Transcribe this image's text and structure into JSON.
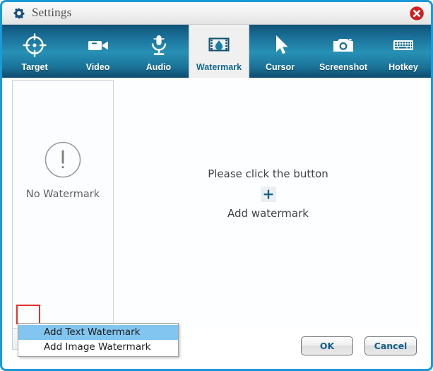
{
  "window": {
    "title": "Settings",
    "title_icon": "gear-icon",
    "close_icon": "close-icon",
    "accent_blue": "#1b9ad6",
    "close_red": "#e02020"
  },
  "tabs": [
    {
      "label": "Target",
      "icon": "target-icon",
      "active": false
    },
    {
      "label": "Video",
      "icon": "video-camera-icon",
      "active": false
    },
    {
      "label": "Audio",
      "icon": "microphone-icon",
      "active": false
    },
    {
      "label": "Watermark",
      "icon": "watermark-icon",
      "active": true
    },
    {
      "label": "Cursor",
      "icon": "cursor-arrow-icon",
      "active": false
    },
    {
      "label": "Screenshot",
      "icon": "camera-icon",
      "active": false
    },
    {
      "label": "Hotkey",
      "icon": "keyboard-icon",
      "active": false
    }
  ],
  "left_panel": {
    "empty_label": "No Watermark",
    "empty_icon": "exclamation-circle-icon",
    "toolbar": [
      {
        "name": "add-watermark-button",
        "icon": "plus-icon",
        "highlighted": true
      },
      {
        "name": "delete-watermark-button",
        "icon": "cross-icon",
        "highlighted": false
      },
      {
        "name": "move-up-button",
        "icon": "arrow-up-icon",
        "highlighted": false
      },
      {
        "name": "move-down-button",
        "icon": "arrow-down-icon",
        "highlighted": false
      }
    ]
  },
  "main_panel": {
    "prompt_line1": "Please click  the button",
    "prompt_icon": "plus-icon",
    "prompt_line2": "Add watermark"
  },
  "context_menu": {
    "items": [
      {
        "label": "Add Text Watermark",
        "highlighted": true
      },
      {
        "label": "Add Image Watermark",
        "highlighted": false
      }
    ]
  },
  "footer": {
    "ok_label": "OK",
    "cancel_label": "Cancel"
  }
}
